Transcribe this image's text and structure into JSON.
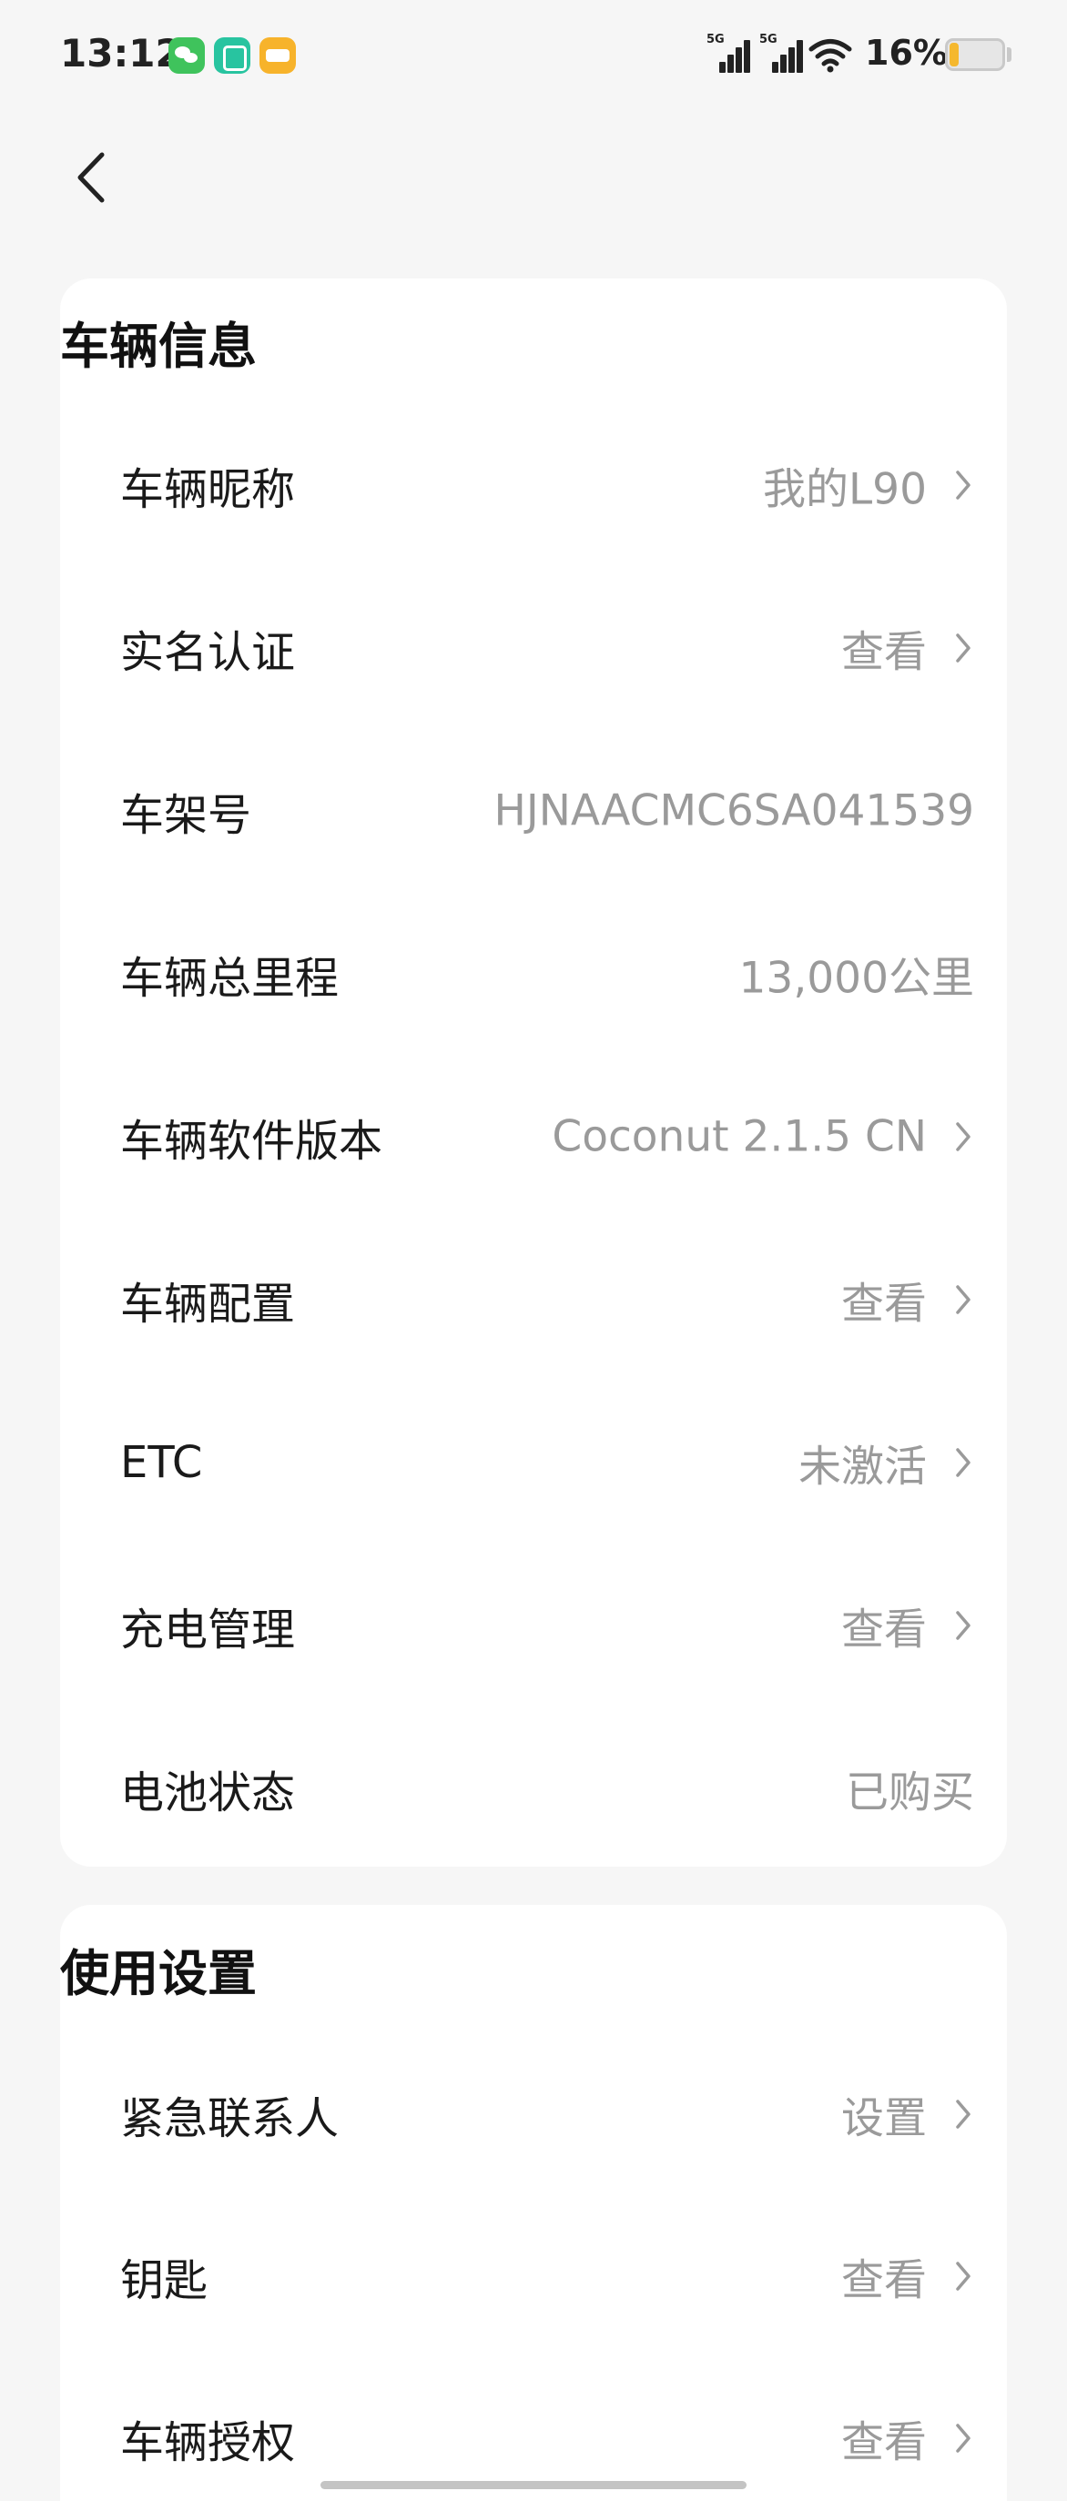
{
  "status_bar": {
    "time": "13:12",
    "apps": [
      "wechat-icon",
      "mi-home-icon",
      "notes-icon"
    ],
    "signal_label": "5G",
    "battery_percent": "16%",
    "battery_level": 0.16,
    "battery_color": "#f5b82e"
  },
  "header": {
    "back_icon": "back-arrow-icon"
  },
  "vehicle_info": {
    "title": "车辆信息",
    "rows": [
      {
        "label": "车辆昵称",
        "value": "我的L90",
        "chevron": true
      },
      {
        "label": "实名认证",
        "value": "查看",
        "chevron": true
      },
      {
        "label": "车架号",
        "value": "HJNAACMC6SA041539",
        "chevron": false
      },
      {
        "label": "车辆总里程",
        "value": "13,000公里",
        "chevron": false
      },
      {
        "label": "车辆软件版本",
        "value": "Coconut 2.1.5 CN",
        "chevron": true
      },
      {
        "label": "车辆配置",
        "value": "查看",
        "chevron": true
      },
      {
        "label": "ETC",
        "value": "未激活",
        "chevron": true
      },
      {
        "label": "充电管理",
        "value": "查看",
        "chevron": true
      },
      {
        "label": "电池状态",
        "value": "已购买",
        "chevron": false
      }
    ]
  },
  "usage_settings": {
    "title": "使用设置",
    "rows": [
      {
        "label": "紧急联系人",
        "value": "设置",
        "chevron": true
      },
      {
        "label": "钥匙",
        "value": "查看",
        "chevron": true
      },
      {
        "label": "车辆授权",
        "value": "查看",
        "chevron": true
      }
    ]
  }
}
